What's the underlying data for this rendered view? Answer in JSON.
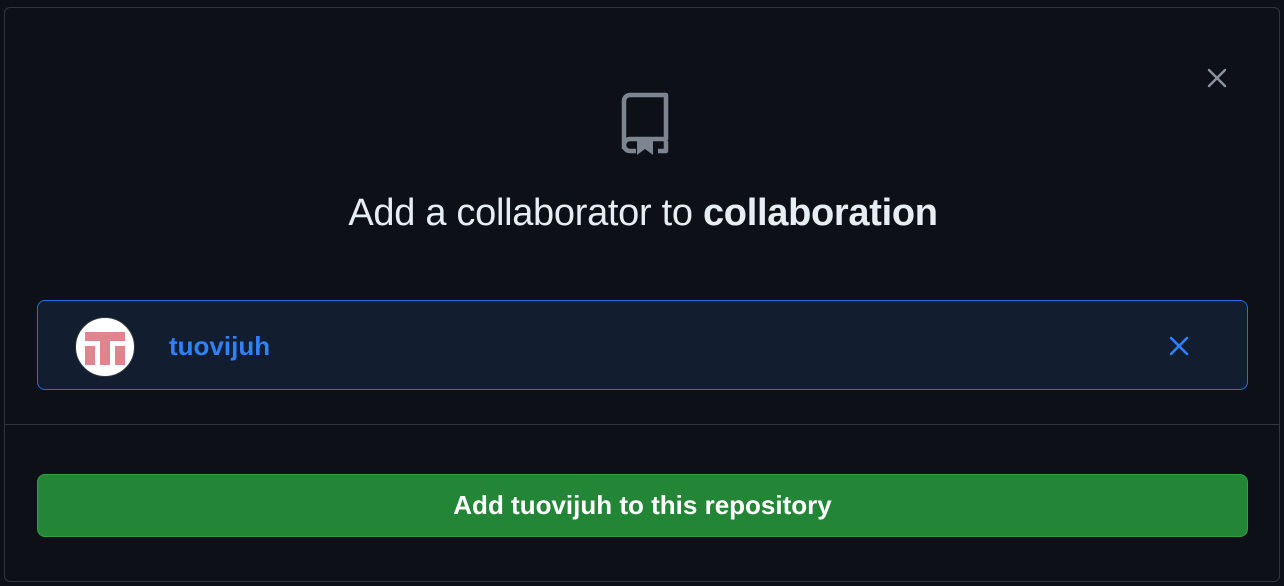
{
  "dialog": {
    "title_prefix": "Add a collaborator to ",
    "repository_name": "collaboration",
    "close_icon": "close-icon",
    "header_icon": "repo-icon"
  },
  "selected_user": {
    "username": "tuovijuh",
    "avatar_icon": "identicon-avatar",
    "remove_icon": "close-icon"
  },
  "actions": {
    "add_button_label": "Add tuovijuh to this repository"
  },
  "colors": {
    "background": "#0d1117",
    "border": "#30363d",
    "accent_blue": "#2f81f7",
    "selected_bg": "#121d2f",
    "primary_button": "#238636",
    "avatar_pattern": "#e0858d"
  }
}
